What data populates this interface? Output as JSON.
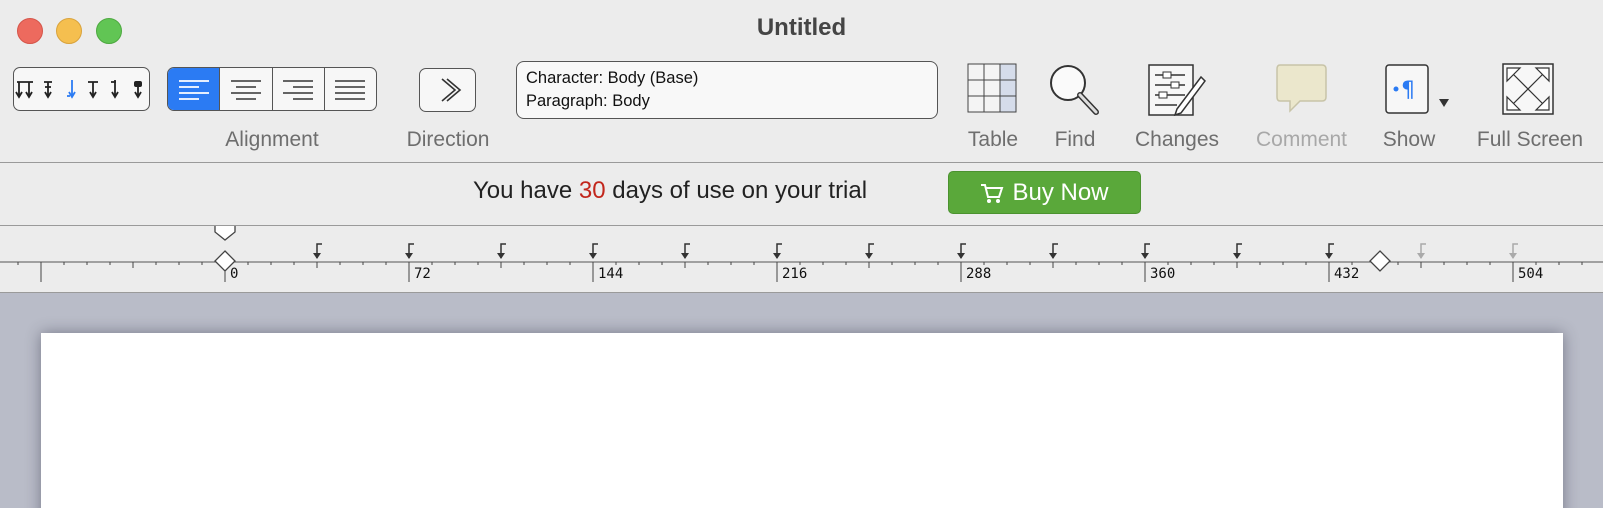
{
  "window": {
    "title": "Untitled"
  },
  "toolbar": {
    "tab_stops": {
      "icons": [
        "left-tab-stop-icon",
        "center-tab-stop-icon",
        "decimal-tab-stop-icon",
        "justify-tab-stop-icon",
        "right-tab-stop-icon",
        "bar-tab-stop-icon"
      ]
    },
    "alignment": {
      "label": "Alignment",
      "options": [
        "left",
        "center",
        "right",
        "justify"
      ],
      "selected": "left"
    },
    "direction": {
      "label": "Direction"
    },
    "style": {
      "character": "Character: Body (Base)",
      "paragraph": "Paragraph: Body"
    },
    "table": {
      "label": "Table"
    },
    "find": {
      "label": "Find"
    },
    "changes": {
      "label": "Changes"
    },
    "comment": {
      "label": "Comment",
      "enabled": false
    },
    "show": {
      "label": "Show"
    },
    "full_screen": {
      "label": "Full Screen"
    }
  },
  "trial": {
    "text_before": "You have",
    "days": "30",
    "text_after": "days of use on your trial",
    "buy_label": "Buy Now"
  },
  "ruler": {
    "labels": [
      "0",
      "72",
      "144",
      "216",
      "288",
      "360",
      "432",
      "504"
    ]
  },
  "colors": {
    "accent": "#2b7bf3",
    "buy_green": "#5aa83a",
    "trial_days_red": "#c2261c",
    "canvas_bg": "#b9bcc8"
  }
}
